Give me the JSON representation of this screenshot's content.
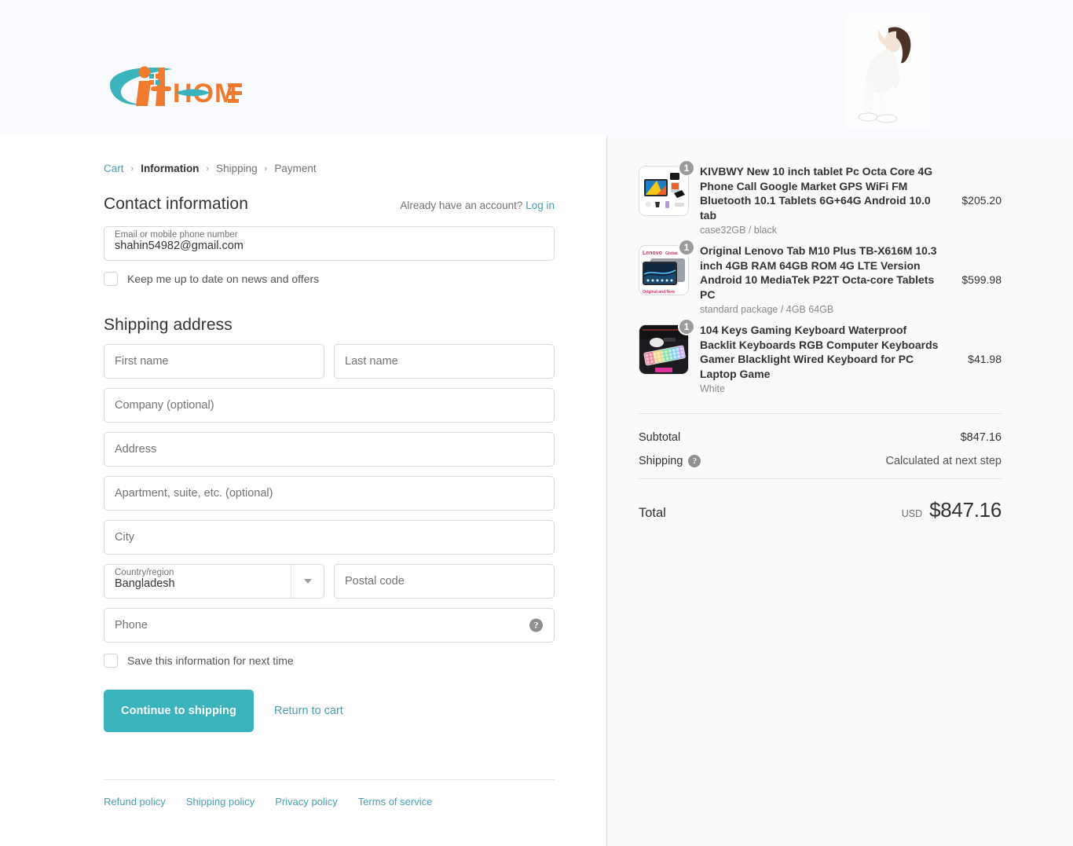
{
  "header": {
    "logo_text": "itHOME",
    "logo_alt": "ithome-logo",
    "hero_alt": "fashion-model-photo"
  },
  "breadcrumb": {
    "items": [
      {
        "label": "Cart",
        "state": "link"
      },
      {
        "label": "Information",
        "state": "current"
      },
      {
        "label": "Shipping",
        "state": "plain"
      },
      {
        "label": "Payment",
        "state": "plain"
      }
    ],
    "separator": "›"
  },
  "contact": {
    "title": "Contact information",
    "account_prompt": "Already have an account?",
    "login_label": "Log in",
    "email_label": "Email or mobile phone number",
    "email_value": "shahin54982@gmail.com",
    "newsletter_label": "Keep me up to date on news and offers"
  },
  "shipping": {
    "title": "Shipping address",
    "first_name_placeholder": "First name",
    "last_name_placeholder": "Last name",
    "company_placeholder": "Company (optional)",
    "address_placeholder": "Address",
    "apartment_placeholder": "Apartment, suite, etc. (optional)",
    "city_placeholder": "City",
    "country_label": "Country/region",
    "country_value": "Bangladesh",
    "postal_placeholder": "Postal code",
    "phone_placeholder": "Phone",
    "phone_help": "?",
    "save_info_label": "Save this information for next time"
  },
  "actions": {
    "continue_label": "Continue to shipping",
    "return_label": "Return to cart"
  },
  "footer": {
    "links": [
      "Refund policy",
      "Shipping policy",
      "Privacy policy",
      "Terms of service"
    ]
  },
  "order_summary": {
    "items": [
      {
        "title": "KIVBWY New 10 inch tablet Pc Octa Core 4G Phone Call Google Market GPS WiFi FM Bluetooth 10.1 Tablets 6G+64G Android 10.0 tab",
        "variant": "case32GB / black",
        "price": "$205.20",
        "qty": "1",
        "thumb_alt": "tablet-product-thumbnail"
      },
      {
        "title": "Original Lenovo Tab M10 Plus TB-X616M 10.3 inch 4GB RAM 64GB ROM 4G LTE Version Android 10 MediaTek P22T Octa-core Tablets PC",
        "variant": "standard package / 4GB 64GB",
        "price": "$599.98",
        "qty": "1",
        "thumb_alt": "lenovo-tab-thumbnail"
      },
      {
        "title": "104 Keys Gaming Keyboard Waterproof Backlit Keyboards RGB Computer Keyboards Gamer Blacklight Wired Keyboard for PC Laptop Game",
        "variant": "White",
        "price": "$41.98",
        "qty": "1",
        "thumb_alt": "rgb-keyboard-thumbnail"
      }
    ],
    "subtotal_label": "Subtotal",
    "subtotal_value": "$847.16",
    "shipping_label": "Shipping",
    "shipping_help": "?",
    "shipping_value": "Calculated at next step",
    "total_label": "Total",
    "currency": "USD",
    "total_value": "$847.16"
  },
  "colors": {
    "accent": "#3bb3bd",
    "link": "#4c9fb0",
    "header_bg": "#fafbfe",
    "summary_bg": "#fafafa"
  }
}
